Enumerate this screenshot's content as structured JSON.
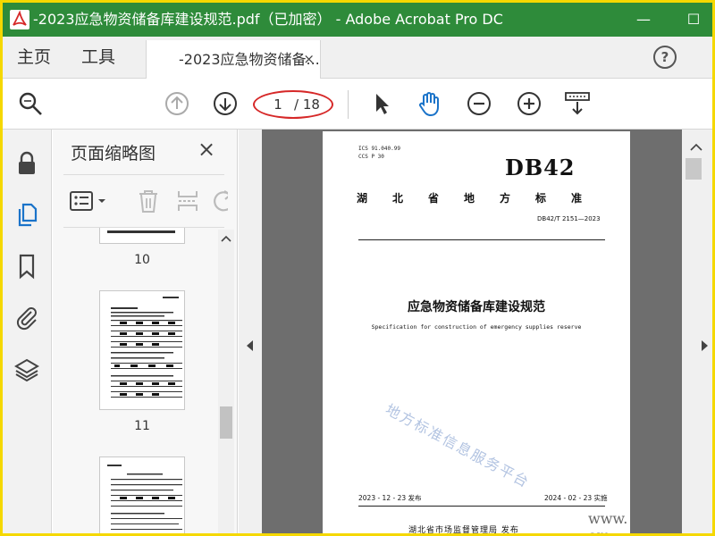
{
  "window": {
    "title": "-2023应急物资储备库建设规范.pdf（已加密） - Adobe Acrobat Pro DC",
    "minimize": "—",
    "maximize": "☐"
  },
  "tabs": {
    "home": "主页",
    "tools": "工具",
    "document": "-2023应急物资储备...",
    "close": "×",
    "help": "?"
  },
  "toolbar": {
    "current_page": "1",
    "total_pages": "/ 18"
  },
  "panel": {
    "title": "页面缩略图",
    "close": "×",
    "thumbnails": [
      {
        "label": "10"
      },
      {
        "label": "11"
      }
    ]
  },
  "document_page": {
    "ics": "ICS 91.040.99",
    "ccs": "CCS P 30",
    "db_code": "DB42",
    "standard_type": "湖北省地方标准",
    "standard_number": "DB42/T 2151—2023",
    "title": "应急物资储备库建设规范",
    "subtitle": "Specification for construction of emergency supplies reserve",
    "publish_date": "2023 - 12 - 23 发布",
    "implement_date": "2024 - 02 - 23 实施",
    "issuer": "湖北省市场监督管理局 发布",
    "watermark": "地方标准信息服务平台"
  },
  "overlay": {
    "url_fragment": "www.",
    "url_end": "om"
  }
}
